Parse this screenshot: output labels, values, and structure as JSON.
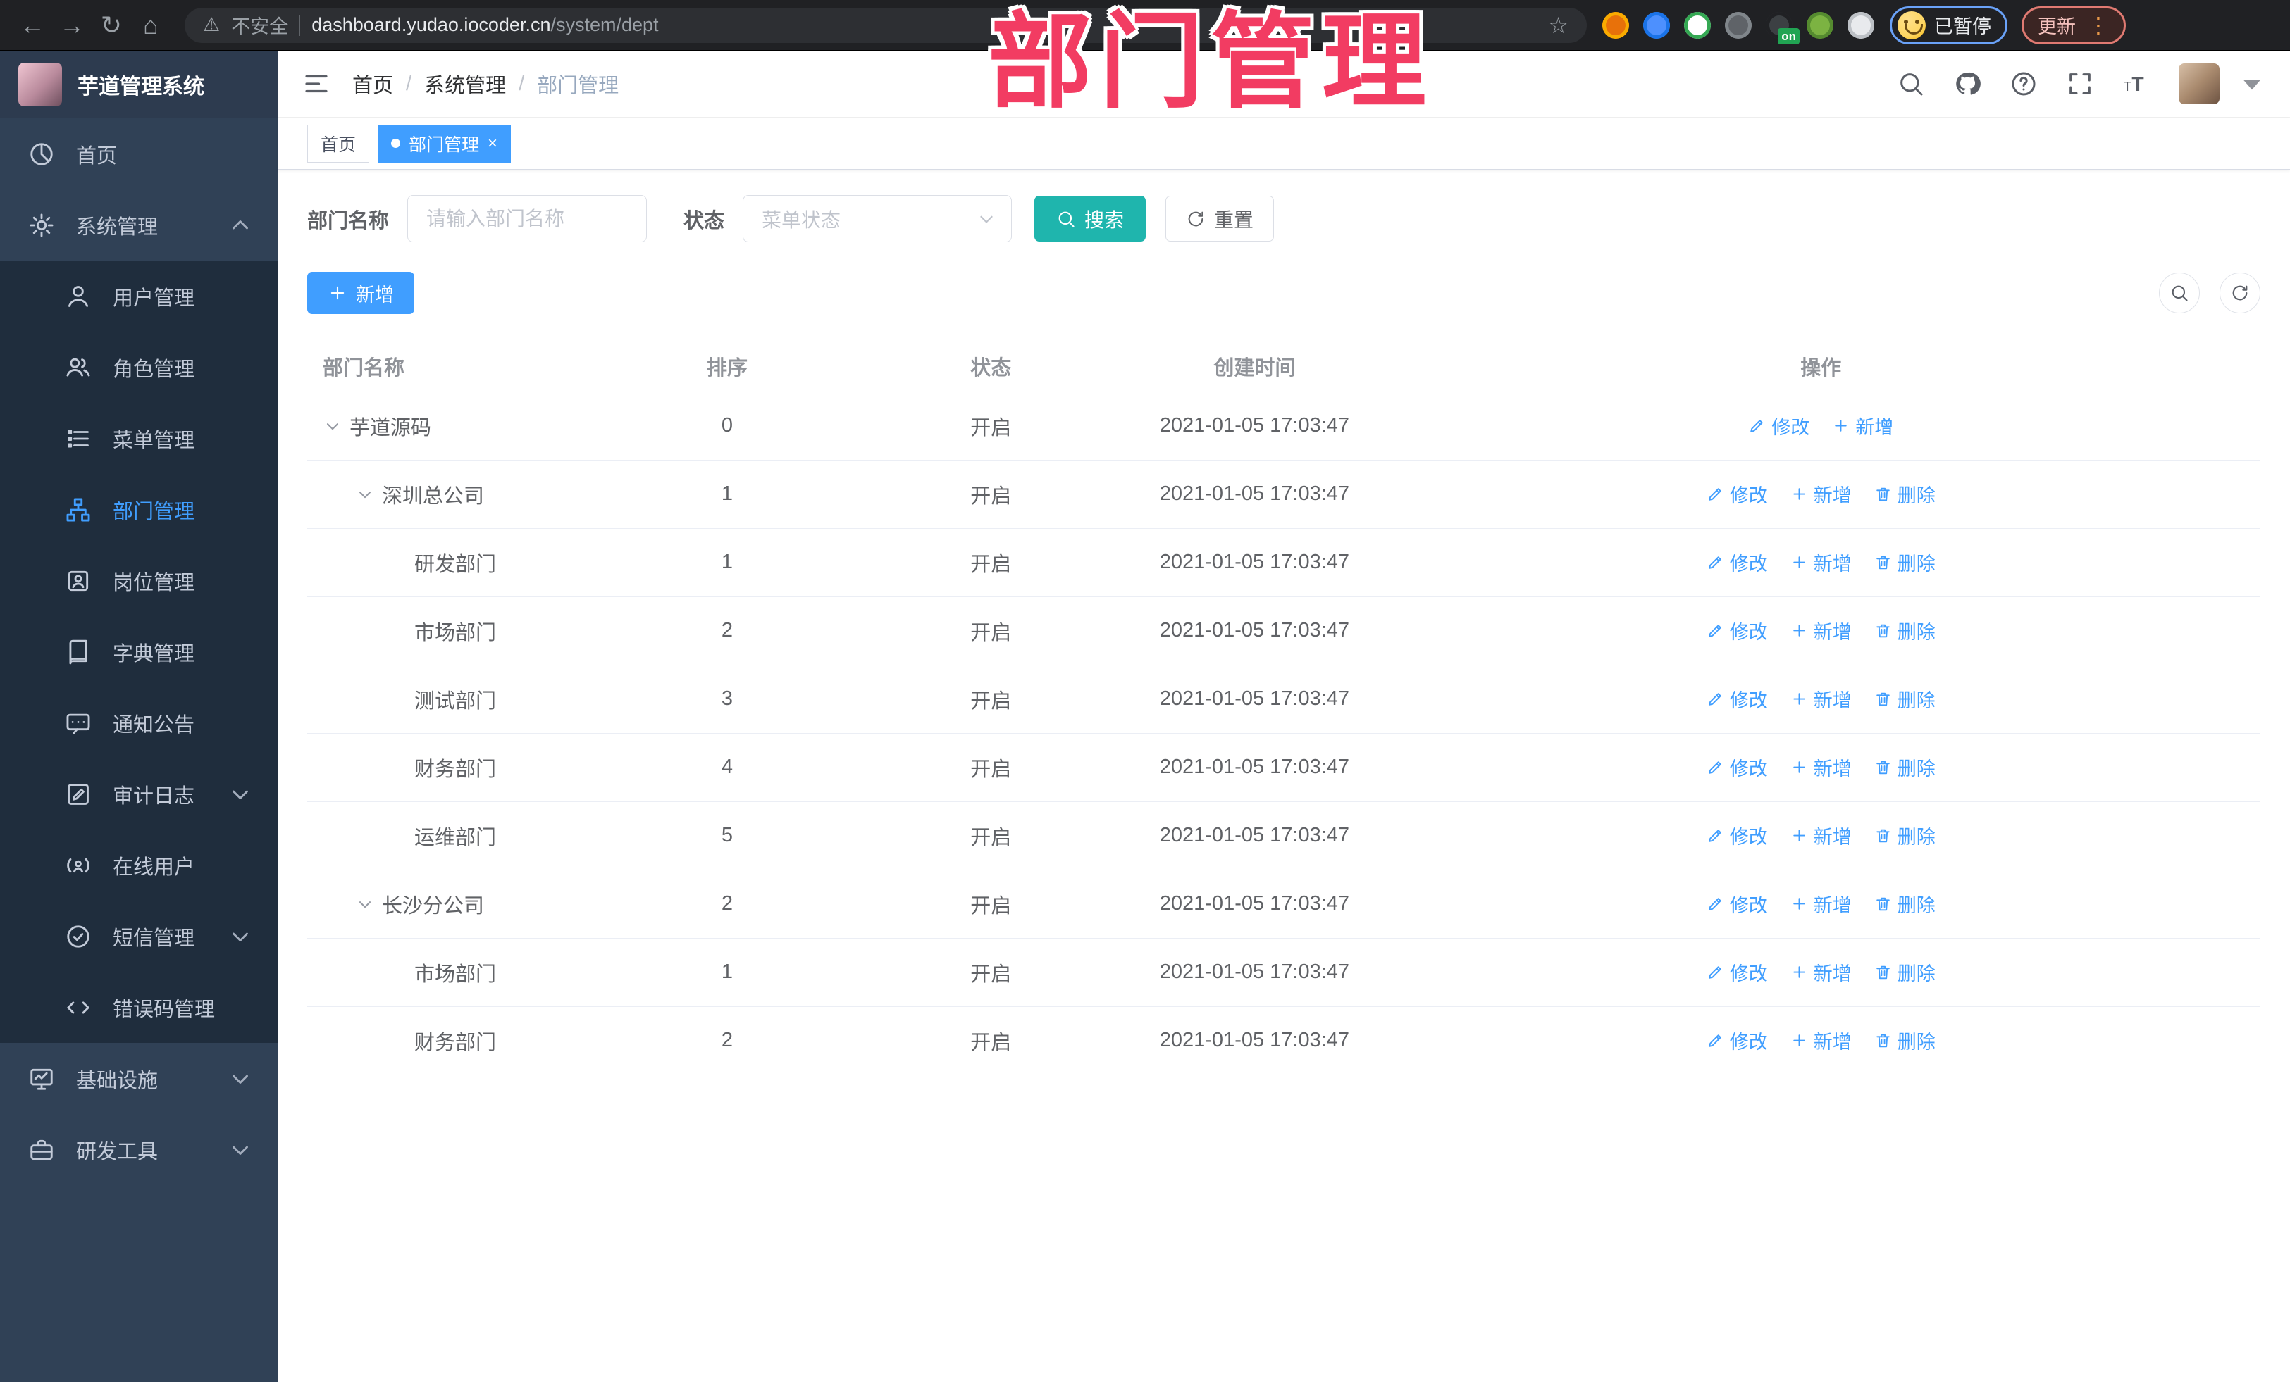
{
  "browser": {
    "nav": [
      {
        "name": "back-icon",
        "glyph": "←"
      },
      {
        "name": "forward-icon",
        "glyph": "→"
      },
      {
        "name": "reload-icon",
        "glyph": "↻"
      },
      {
        "name": "home-icon",
        "glyph": "⌂"
      }
    ],
    "warning_glyph": "⚠",
    "security_label": "不安全",
    "url_host": "dashboard.yudao.iocoder.cn",
    "url_path": "/system/dept",
    "star_glyph": "☆",
    "extensions": [
      {
        "name": "extension-orange-icon",
        "color": "#e8710a",
        "ring": "#f9ab00"
      },
      {
        "name": "extension-blue-gem-icon",
        "color": "#4d90fe",
        "ring": "#1a73e8"
      },
      {
        "name": "extension-green-check-icon",
        "color": "#ffffff",
        "ring": "#34a853"
      },
      {
        "name": "extension-grid-icon",
        "color": "#5f6368",
        "ring": "#80868b"
      },
      {
        "name": "extension-dark-on-icon",
        "color": "#3c4043",
        "ring": "#202124",
        "badge": "on"
      },
      {
        "name": "extension-lime-key-icon",
        "color": "#7cb342",
        "ring": "#558b2f"
      },
      {
        "name": "extension-puzzle-icon",
        "color": "#e8eaed",
        "ring": "#bdc1c6"
      }
    ],
    "paused_chip_label": "已暂停",
    "update_button_label": "更新",
    "menu_dots_glyph": "⋮"
  },
  "overlay": {
    "title": "部门管理",
    "color": "#f23c62"
  },
  "sidebar": {
    "app_title": "芋道管理系统",
    "items": [
      {
        "label": "首页",
        "icon": "dashboard-icon"
      },
      {
        "label": "系统管理",
        "icon": "gear-icon",
        "expanded": true,
        "children": [
          {
            "label": "用户管理",
            "icon": "user-icon"
          },
          {
            "label": "角色管理",
            "icon": "users-icon"
          },
          {
            "label": "菜单管理",
            "icon": "menu-list-icon"
          },
          {
            "label": "部门管理",
            "icon": "org-tree-icon",
            "active": true
          },
          {
            "label": "岗位管理",
            "icon": "id-badge-icon"
          },
          {
            "label": "字典管理",
            "icon": "dictionary-icon"
          },
          {
            "label": "通知公告",
            "icon": "announcement-icon"
          },
          {
            "label": "审计日志",
            "icon": "audit-log-icon",
            "chevron": "down"
          },
          {
            "label": "在线用户",
            "icon": "online-user-icon"
          },
          {
            "label": "短信管理",
            "icon": "sms-icon",
            "chevron": "down"
          },
          {
            "label": "错误码管理",
            "icon": "error-code-icon"
          }
        ]
      },
      {
        "label": "基础设施",
        "icon": "infrastructure-icon",
        "chevron": "down"
      },
      {
        "label": "研发工具",
        "icon": "dev-tools-icon",
        "chevron": "down"
      }
    ]
  },
  "header": {
    "breadcrumb": [
      "首页",
      "系统管理",
      "部门管理"
    ],
    "separator": "/"
  },
  "tabs": [
    {
      "label": "首页",
      "active": false,
      "closable": false
    },
    {
      "label": "部门管理",
      "active": true,
      "closable": true
    }
  ],
  "filters": {
    "name_label": "部门名称",
    "name_placeholder": "请输入部门名称",
    "status_label": "状态",
    "status_placeholder": "菜单状态",
    "search_label": "搜索",
    "reset_label": "重置"
  },
  "toolbar": {
    "add_label": "新增"
  },
  "table": {
    "columns": [
      "部门名称",
      "排序",
      "状态",
      "创建时间",
      "操作"
    ],
    "action_icons": {
      "修改": "edit-icon",
      "新增": "plus-icon",
      "删除": "trash-icon"
    },
    "rows": [
      {
        "name": "芋道源码",
        "level": 0,
        "expandable": true,
        "sort": "0",
        "status": "开启",
        "created": "2021-01-05 17:03:47",
        "actions": [
          "修改",
          "新增"
        ]
      },
      {
        "name": "深圳总公司",
        "level": 1,
        "expandable": true,
        "sort": "1",
        "status": "开启",
        "created": "2021-01-05 17:03:47",
        "actions": [
          "修改",
          "新增",
          "删除"
        ]
      },
      {
        "name": "研发部门",
        "level": 2,
        "expandable": false,
        "sort": "1",
        "status": "开启",
        "created": "2021-01-05 17:03:47",
        "actions": [
          "修改",
          "新增",
          "删除"
        ]
      },
      {
        "name": "市场部门",
        "level": 2,
        "expandable": false,
        "sort": "2",
        "status": "开启",
        "created": "2021-01-05 17:03:47",
        "actions": [
          "修改",
          "新增",
          "删除"
        ]
      },
      {
        "name": "测试部门",
        "level": 2,
        "expandable": false,
        "sort": "3",
        "status": "开启",
        "created": "2021-01-05 17:03:47",
        "actions": [
          "修改",
          "新增",
          "删除"
        ]
      },
      {
        "name": "财务部门",
        "level": 2,
        "expandable": false,
        "sort": "4",
        "status": "开启",
        "created": "2021-01-05 17:03:47",
        "actions": [
          "修改",
          "新增",
          "删除"
        ]
      },
      {
        "name": "运维部门",
        "level": 2,
        "expandable": false,
        "sort": "5",
        "status": "开启",
        "created": "2021-01-05 17:03:47",
        "actions": [
          "修改",
          "新增",
          "删除"
        ]
      },
      {
        "name": "长沙分公司",
        "level": 1,
        "expandable": true,
        "sort": "2",
        "status": "开启",
        "created": "2021-01-05 17:03:47",
        "actions": [
          "修改",
          "新增",
          "删除"
        ]
      },
      {
        "name": "市场部门",
        "level": 2,
        "expandable": false,
        "sort": "1",
        "status": "开启",
        "created": "2021-01-05 17:03:47",
        "actions": [
          "修改",
          "新增",
          "删除"
        ]
      },
      {
        "name": "财务部门",
        "level": 2,
        "expandable": false,
        "sort": "2",
        "status": "开启",
        "created": "2021-01-05 17:03:47",
        "actions": [
          "修改",
          "新增",
          "删除"
        ]
      }
    ]
  },
  "colors": {
    "accent_blue": "#409eff",
    "teal_button": "#1fb5ad",
    "sidebar_bg": "#304156",
    "submenu_bg": "#1f2d3d",
    "overlay_pink": "#f23c62"
  }
}
